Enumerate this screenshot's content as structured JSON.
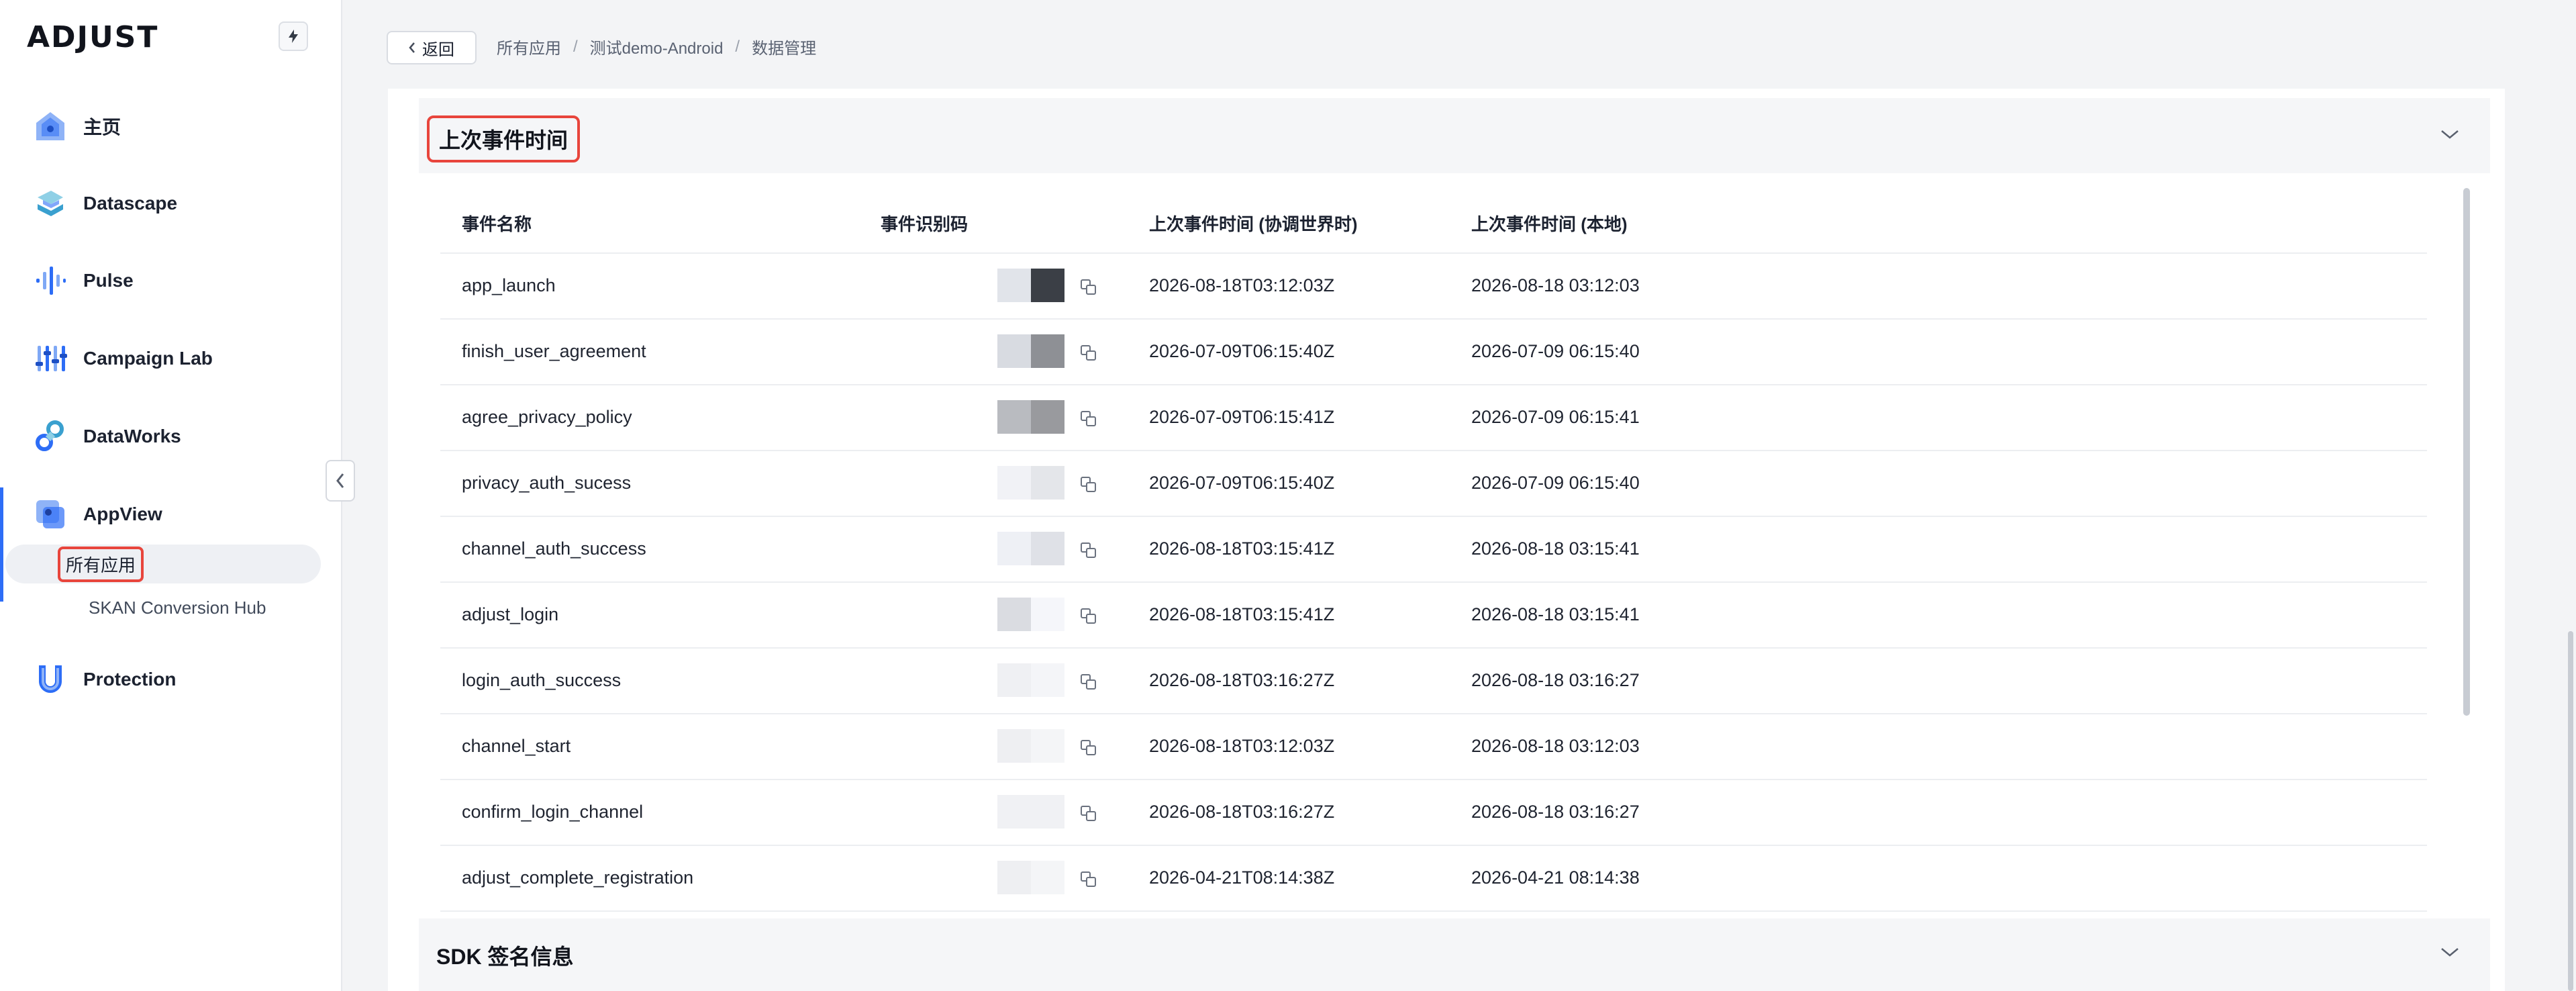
{
  "brand": {
    "logo_text": "ADJUST",
    "bolt_icon": "bolt-icon"
  },
  "sidebar": {
    "items": [
      {
        "label": "主页",
        "icon": "home-icon"
      },
      {
        "label": "Datascape",
        "icon": "datascape-icon"
      },
      {
        "label": "Pulse",
        "icon": "pulse-icon"
      },
      {
        "label": "Campaign Lab",
        "icon": "campaign-lab-icon"
      },
      {
        "label": "DataWorks",
        "icon": "dataworks-icon"
      },
      {
        "label": "AppView",
        "icon": "appview-icon"
      },
      {
        "label": "Protection",
        "icon": "protection-icon"
      }
    ],
    "sub_items": [
      {
        "label": "所有应用"
      },
      {
        "label": "SKAN Conversion Hub"
      }
    ]
  },
  "topbar": {
    "back_label": "返回",
    "breadcrumb": [
      "所有应用",
      "测试demo-Android",
      "数据管理"
    ]
  },
  "sections": {
    "last_event": {
      "title": "上次事件时间"
    },
    "sdk": {
      "title": "SDK 签名信息"
    }
  },
  "table": {
    "headers": [
      "事件名称",
      "事件识别码",
      "上次事件时间 (协调世界时)",
      "上次事件时间 (本地)"
    ],
    "rows": [
      {
        "name": "app_launch",
        "utc": "2026-08-18T03:12:03Z",
        "local": "2026-08-18 03:12:03"
      },
      {
        "name": "finish_user_agreement",
        "utc": "2026-07-09T06:15:40Z",
        "local": "2026-07-09 06:15:40"
      },
      {
        "name": "agree_privacy_policy",
        "utc": "2026-07-09T06:15:41Z",
        "local": "2026-07-09 06:15:41"
      },
      {
        "name": "privacy_auth_sucess",
        "utc": "2026-07-09T06:15:40Z",
        "local": "2026-07-09 06:15:40"
      },
      {
        "name": "channel_auth_success",
        "utc": "2026-08-18T03:15:41Z",
        "local": "2026-08-18 03:15:41"
      },
      {
        "name": "adjust_login",
        "utc": "2026-08-18T03:15:41Z",
        "local": "2026-08-18 03:15:41"
      },
      {
        "name": "login_auth_success",
        "utc": "2026-08-18T03:16:27Z",
        "local": "2026-08-18 03:16:27"
      },
      {
        "name": "channel_start",
        "utc": "2026-08-18T03:12:03Z",
        "local": "2026-08-18 03:12:03"
      },
      {
        "name": "confirm_login_channel",
        "utc": "2026-08-18T03:16:27Z",
        "local": "2026-08-18 03:16:27"
      },
      {
        "name": "adjust_complete_registration",
        "utc": "2026-04-21T08:14:38Z",
        "local": "2026-04-21 08:14:38"
      }
    ]
  },
  "colors": {
    "accent": "#2d6df6",
    "highlight": "#e8453c"
  }
}
